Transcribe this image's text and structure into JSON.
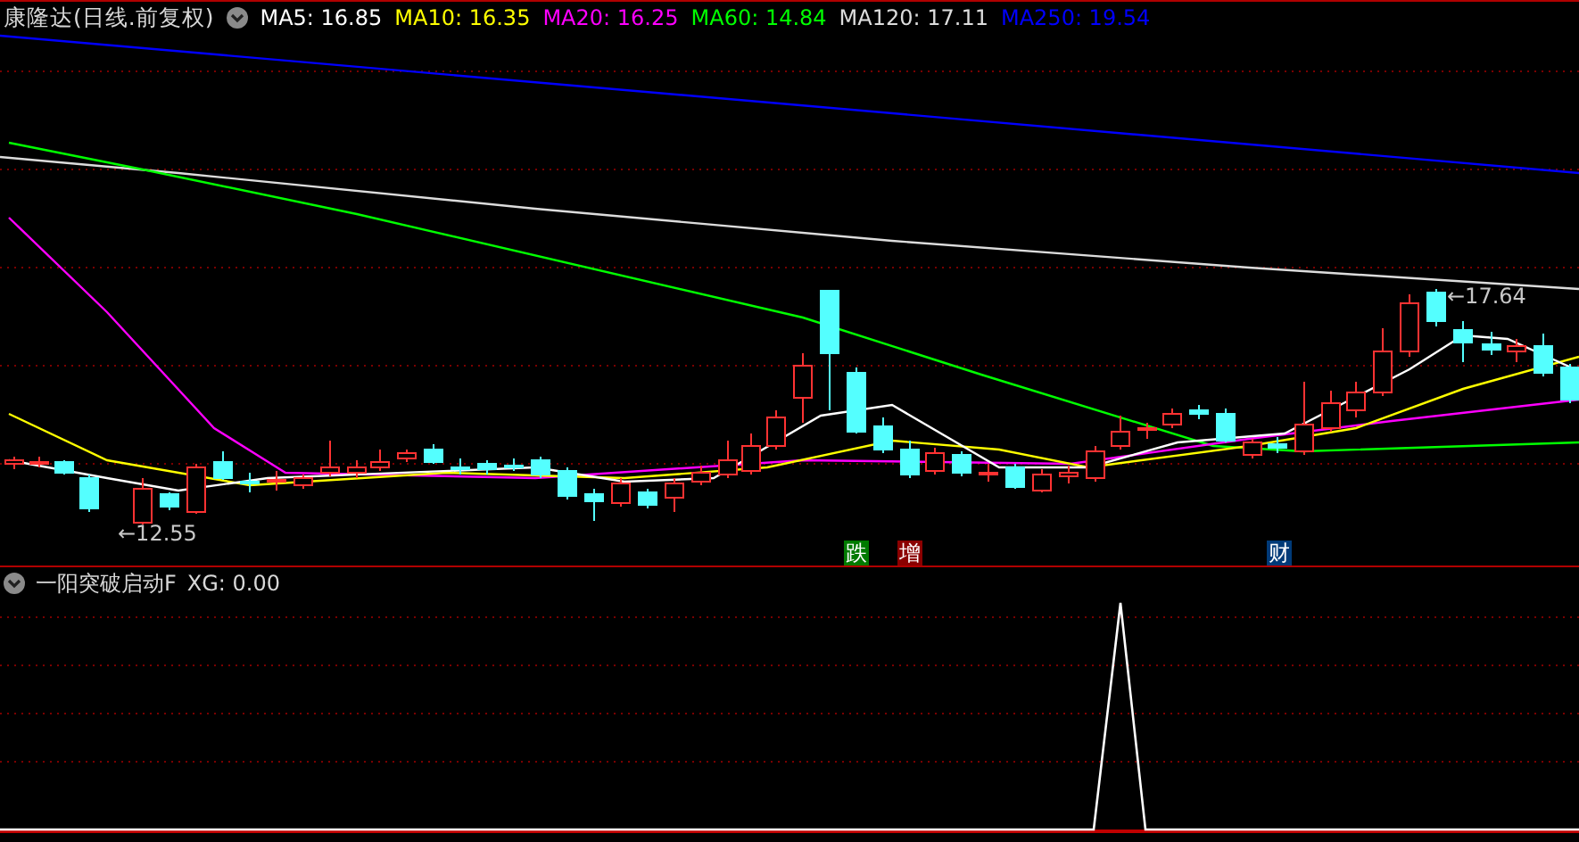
{
  "main_chart": {
    "title": "康隆达(日线.前复权)",
    "legend": [
      {
        "text": "MA5: 16.85",
        "color": "#ffffff"
      },
      {
        "text": "MA10: 16.35",
        "color": "#ffff00"
      },
      {
        "text": "MA20: 16.25",
        "color": "#ff00ff"
      },
      {
        "text": "MA60: 14.84",
        "color": "#00ff00"
      },
      {
        "text": "MA120: 17.11",
        "color": "#dcdcdc"
      },
      {
        "text": "MA250: 19.54",
        "color": "#0000ff"
      }
    ],
    "price_labels": [
      {
        "text": "←12.55",
        "kind": "low"
      },
      {
        "text": "←17.64",
        "kind": "high"
      }
    ],
    "event_badges": [
      {
        "text": "跌",
        "color": "#007a00"
      },
      {
        "text": "增",
        "color": "#8b0000"
      },
      {
        "text": "财",
        "color": "#003a78"
      }
    ]
  },
  "indicator": {
    "name": "一阳突破启动F",
    "reading": "XG: 0.00"
  }
}
